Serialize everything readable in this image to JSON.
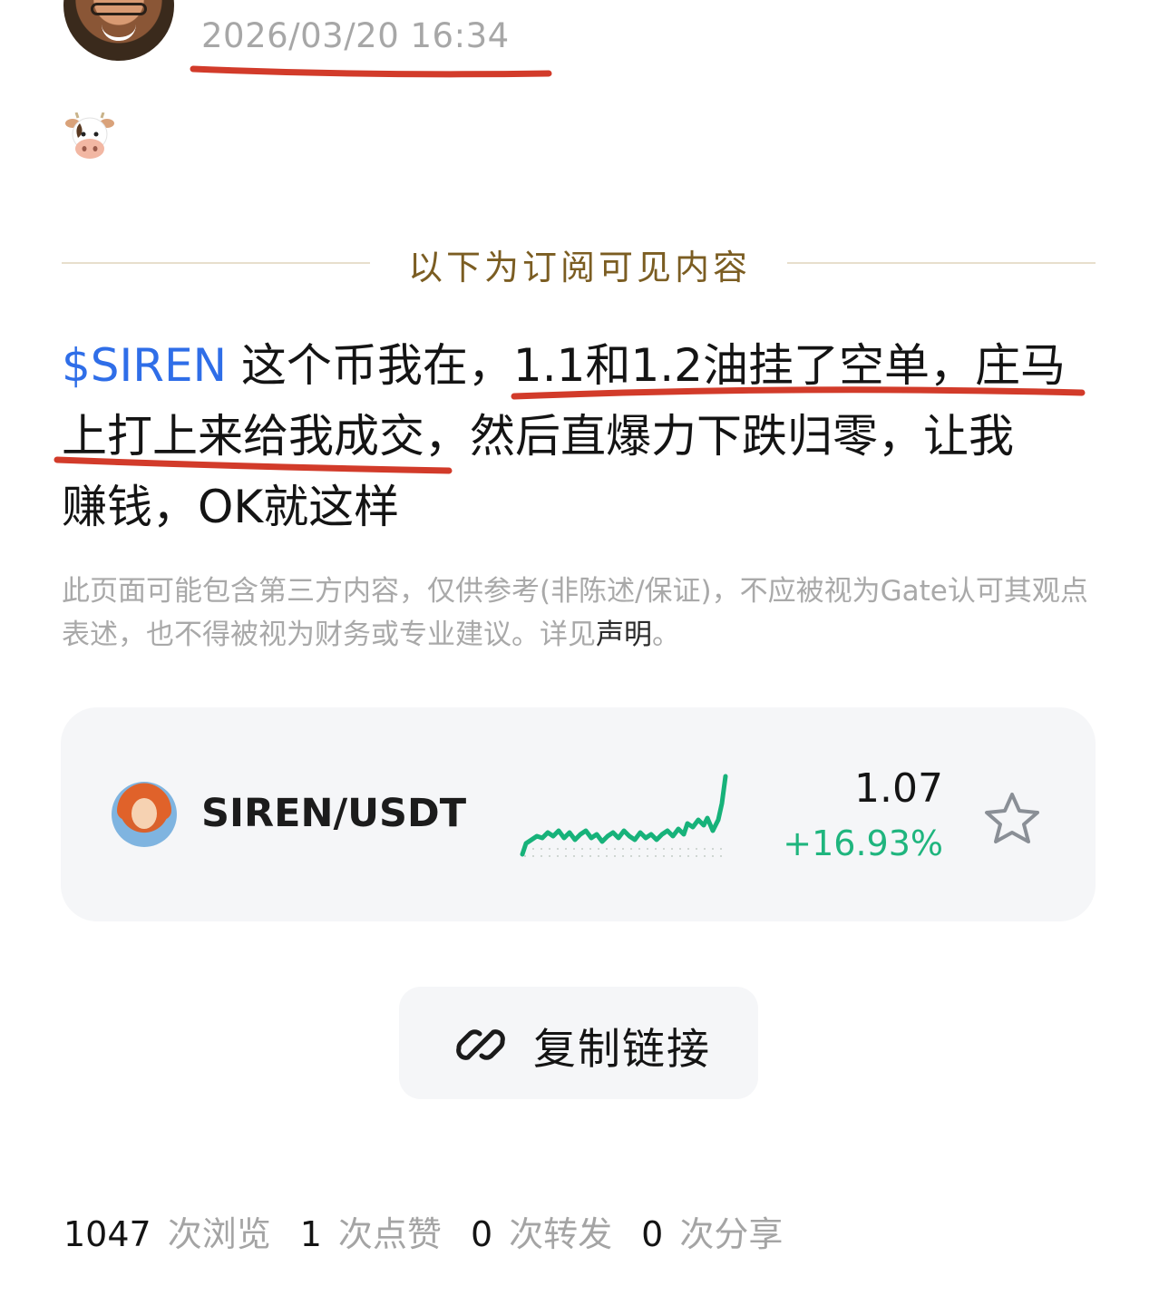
{
  "header": {
    "timestamp": "2026/03/20 16:34"
  },
  "divider": {
    "label": "以下为订阅可见内容"
  },
  "post": {
    "ticker": "$SIREN",
    "line1_rest": " 这个币我在，1.1和1.2油挂了空单，庄马",
    "line2": "上打上来给我成交，然后直爆力下跌归零，让我",
    "line3": "赚钱，OK就这样"
  },
  "disclaimer": {
    "text": "此页面可能包含第三方内容，仅供参考(非陈述/保证)，不应被视为Gate认可其观点表述，也不得被视为财务或专业建议。详见",
    "link": "声明",
    "tail": "。"
  },
  "ticker_card": {
    "pair": "SIREN/USDT",
    "price": "1.07",
    "change": "+16.93%",
    "change_color": "#1fb57e",
    "icon": "star-icon"
  },
  "copy_button": {
    "label": "复制链接",
    "icon": "link-icon"
  },
  "stats": {
    "views": "1047",
    "views_label": "次浏览",
    "likes": "1",
    "likes_label": "次点赞",
    "reposts": "0",
    "reposts_label": "次转发",
    "shares": "0",
    "shares_label": "次分享"
  },
  "colors": {
    "ticker_link": "#2f6ee8",
    "annotation": "#d23b2a",
    "divider_text": "#7b5d22"
  }
}
